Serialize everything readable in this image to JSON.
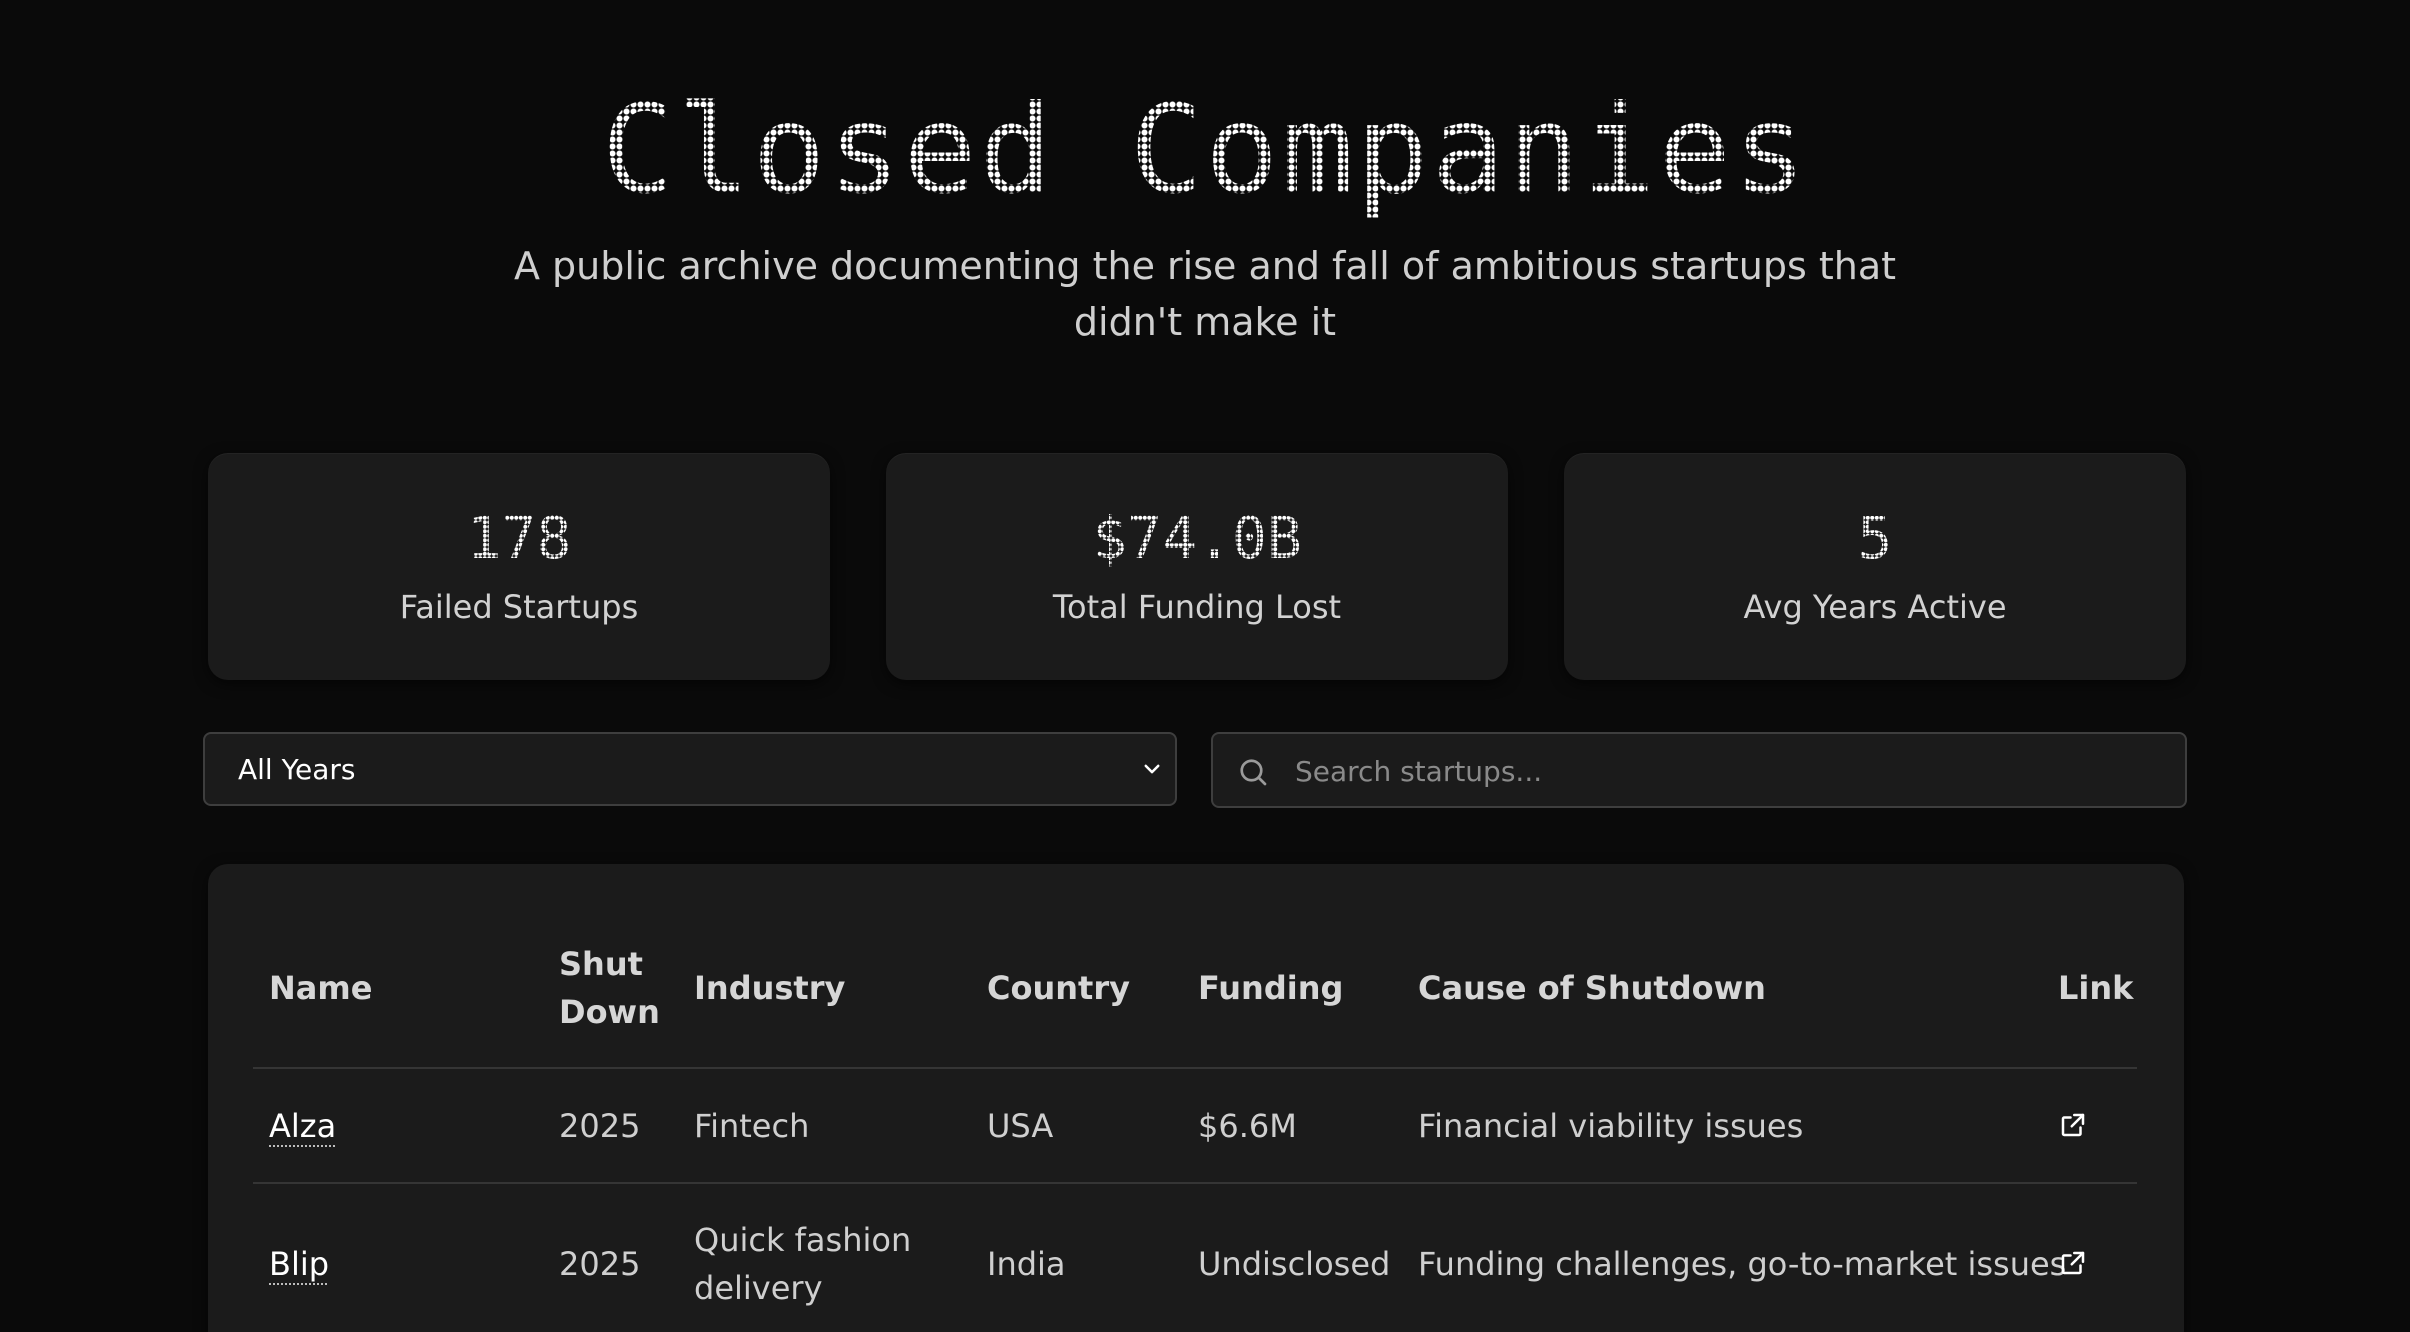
{
  "header": {
    "title": "Closed Companies",
    "subtitle": "A public archive documenting the rise and fall of ambitious startups that didn't make it"
  },
  "stats": [
    {
      "value": "178",
      "label": "Failed Startups"
    },
    {
      "value": "$74.0B",
      "label": "Total Funding Lost"
    },
    {
      "value": "5",
      "label": "Avg Years Active"
    }
  ],
  "filters": {
    "year_select": {
      "selected": "All Years",
      "icon": "chevron-down-icon"
    },
    "search": {
      "placeholder": "Search startups...",
      "value": "",
      "icon": "search-icon"
    }
  },
  "table": {
    "columns": [
      "Name",
      "Shut Down",
      "Industry",
      "Country",
      "Funding",
      "Cause of Shutdown",
      "Link"
    ],
    "rows": [
      {
        "name": "Alza",
        "shut_down": "2025",
        "industry": "Fintech",
        "country": "USA",
        "funding": "$6.6M",
        "cause": "Financial viability issues",
        "link_icon": "external-link-icon"
      },
      {
        "name": "Blip",
        "shut_down": "2025",
        "industry": "Quick fashion delivery",
        "country": "India",
        "funding": "Undisclosed",
        "cause": "Funding challenges, go-to-market issues",
        "link_icon": "external-link-icon"
      }
    ]
  },
  "colors": {
    "background": "#0a0a0a",
    "card": "#1b1b1b",
    "border": "#3e3e3e",
    "text": "#d8d8d8",
    "accent_text": "#ffffff"
  }
}
